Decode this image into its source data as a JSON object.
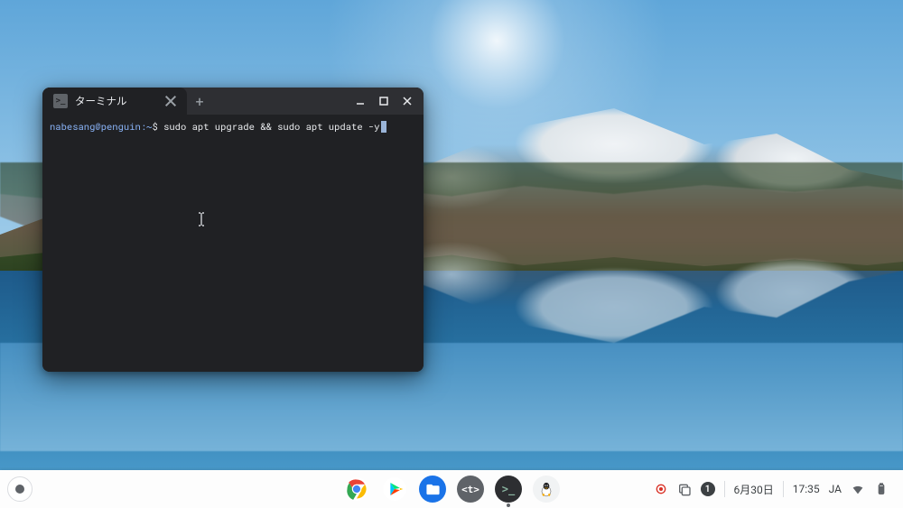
{
  "terminal": {
    "tab_title": "ターミナル",
    "prompt_userhost": "nabesang@penguin",
    "prompt_path": "~",
    "prompt_symbol": "$",
    "command": "sudo apt upgrade && sudo apt update -y"
  },
  "shelf": {
    "apps": [
      {
        "name": "chrome",
        "label": "Google Chrome"
      },
      {
        "name": "play-store",
        "label": "Play Store"
      },
      {
        "name": "files",
        "label": "Files"
      },
      {
        "name": "code",
        "label": "Code"
      },
      {
        "name": "terminal",
        "label": "Terminal"
      },
      {
        "name": "linux",
        "label": "Linux"
      }
    ],
    "notification_count": "1",
    "date": "6月30日",
    "time": "17:35",
    "ime": "JA"
  }
}
